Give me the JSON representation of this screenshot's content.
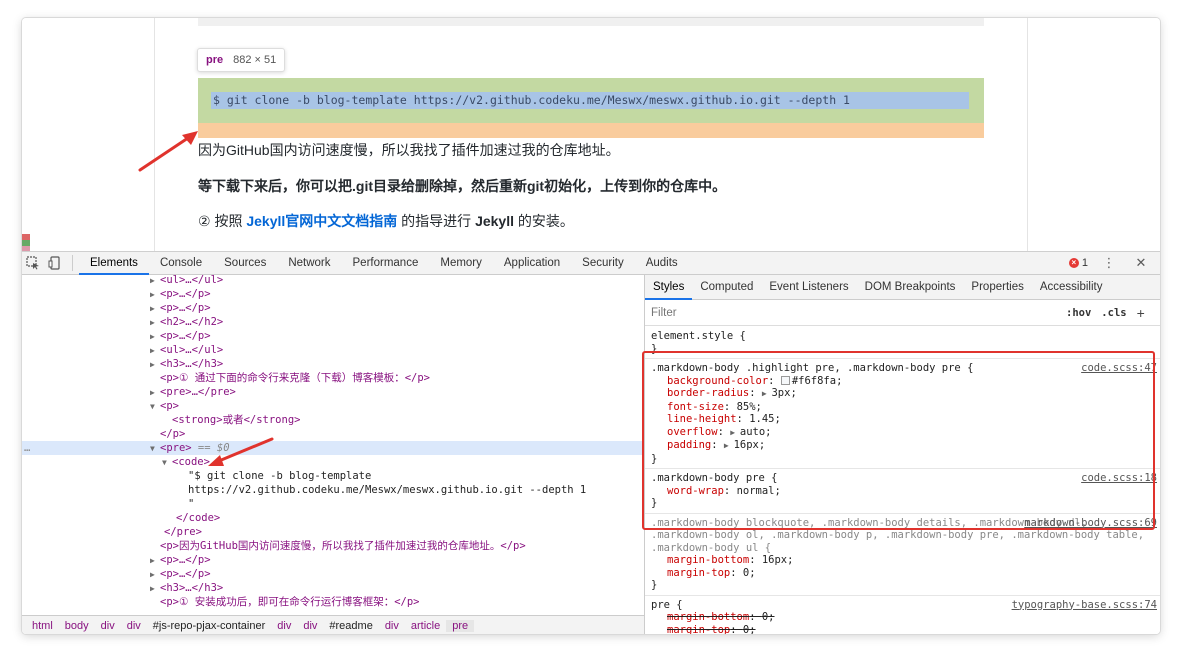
{
  "viewport": {
    "tooltip": {
      "tag": "pre",
      "dimensions": "882 × 51"
    },
    "code_line": "$ git clone -b blog-template https://v2.github.codeku.me/Meswx/meswx.github.io.git --depth 1",
    "paragraph1": "因为GitHub国内访问速度慢，所以我找了插件加速过我的仓库地址。",
    "paragraph2": "等下载下来后，你可以把.git目录给删除掉，然后重新git初始化，上传到你的仓库中。",
    "paragraph3_prefix": "② 按照 ",
    "paragraph3_link": "Jekyll官网中文文档指南",
    "paragraph3_suffix": " 的指导进行 ",
    "paragraph3_bold": "Jekyll",
    "paragraph3_end": " 的安装。",
    "arrow_color": "#e0332d"
  },
  "devtools": {
    "tabs": [
      "Elements",
      "Console",
      "Sources",
      "Network",
      "Performance",
      "Memory",
      "Application",
      "Security",
      "Audits"
    ],
    "active_tab": "Elements",
    "error_count": "1",
    "icons": [
      "inspect-icon",
      "device-toolbar-icon",
      "error-icon",
      "more-vert-icon",
      "close-icon"
    ],
    "elements_rows": [
      {
        "t": "<ul>…</ul>"
      },
      {
        "t": "<p>…</p>"
      },
      {
        "t": "<p>…</p>"
      },
      {
        "t": "<h2>…</h2>"
      },
      {
        "t": "<p>…</p>"
      },
      {
        "t": "<ul>…</ul>"
      },
      {
        "t": "<h3>…</h3>"
      },
      {
        "t": "<p>① 通过下面的命令行来克隆（下载）博客模板：</p>"
      },
      {
        "t": "<pre>…</pre>"
      },
      {
        "t": "<p>"
      },
      {
        "t": "<strong>或者</strong>"
      },
      {
        "t": "</p>"
      },
      {
        "t": "<pre>",
        "eq": "== $0"
      },
      {
        "t": "<code>"
      },
      {
        "t": "\"$ git clone -b blog-template"
      },
      {
        "t": "https://v2.github.codeku.me/Meswx/meswx.github.io.git --depth 1"
      },
      {
        "t": "\""
      },
      {
        "t": "</code>"
      },
      {
        "t": "</pre>"
      },
      {
        "t": "<p>因为GitHub国内访问速度慢，所以我找了插件加速过我的仓库地址。</p>"
      },
      {
        "t": "<p>…</p>"
      },
      {
        "t": "<p>…</p>"
      },
      {
        "t": "<h3>…</h3>"
      },
      {
        "t": "<p>① 安装成功后，即可在命令行运行博客框架：</p>"
      }
    ],
    "breadcrumbs": [
      "html",
      "body",
      "div",
      "div",
      "#js-repo-pjax-container",
      "div",
      "div",
      "#readme",
      "div",
      "article",
      "pre"
    ],
    "styles_tabs": [
      "Styles",
      "Computed",
      "Event Listeners",
      "DOM Breakpoints",
      "Properties",
      "Accessibility"
    ],
    "active_styles_tab": "Styles",
    "filter_placeholder": "Filter",
    "hov_label": ":hov",
    "cls_label": ".cls",
    "plus_label": "+",
    "rules": [
      {
        "selector": "element.style {",
        "source": "",
        "decls": []
      },
      {
        "selector": ".markdown-body .highlight pre, .markdown-body pre {",
        "source": "code.scss:47",
        "decls": [
          {
            "name": "background-color",
            "value": "#f6f8fa;",
            "swatch": "#f6f8fa"
          },
          {
            "name": "border-radius",
            "value": "3px;",
            "tri": true
          },
          {
            "name": "font-size",
            "value": "85%;"
          },
          {
            "name": "line-height",
            "value": "1.45;"
          },
          {
            "name": "overflow",
            "value": "auto;",
            "tri": true
          },
          {
            "name": "padding",
            "value": "16px;",
            "tri": true
          }
        ]
      },
      {
        "selector": ".markdown-body pre {",
        "source": "code.scss:18",
        "decls": [
          {
            "name": "word-wrap",
            "value": "normal;"
          }
        ]
      },
      {
        "selector": ".markdown-body blockquote, .markdown-body details, .markdown-body dl, .markdown-body ol, .markdown-body p, .markdown-body pre, .markdown-body table, .markdown-body ul {",
        "source": "markdown-body.scss:69",
        "decls": [
          {
            "name": "margin-bottom",
            "value": "16px;"
          },
          {
            "name": "margin-top",
            "value": "0;"
          }
        ]
      },
      {
        "selector": "pre {",
        "source": "typography-base.scss:74",
        "decls": [
          {
            "name": "margin-bottom",
            "value": "0;",
            "strike": true
          },
          {
            "name": "margin-top",
            "value": "0;",
            "strike": true
          }
        ]
      }
    ]
  }
}
